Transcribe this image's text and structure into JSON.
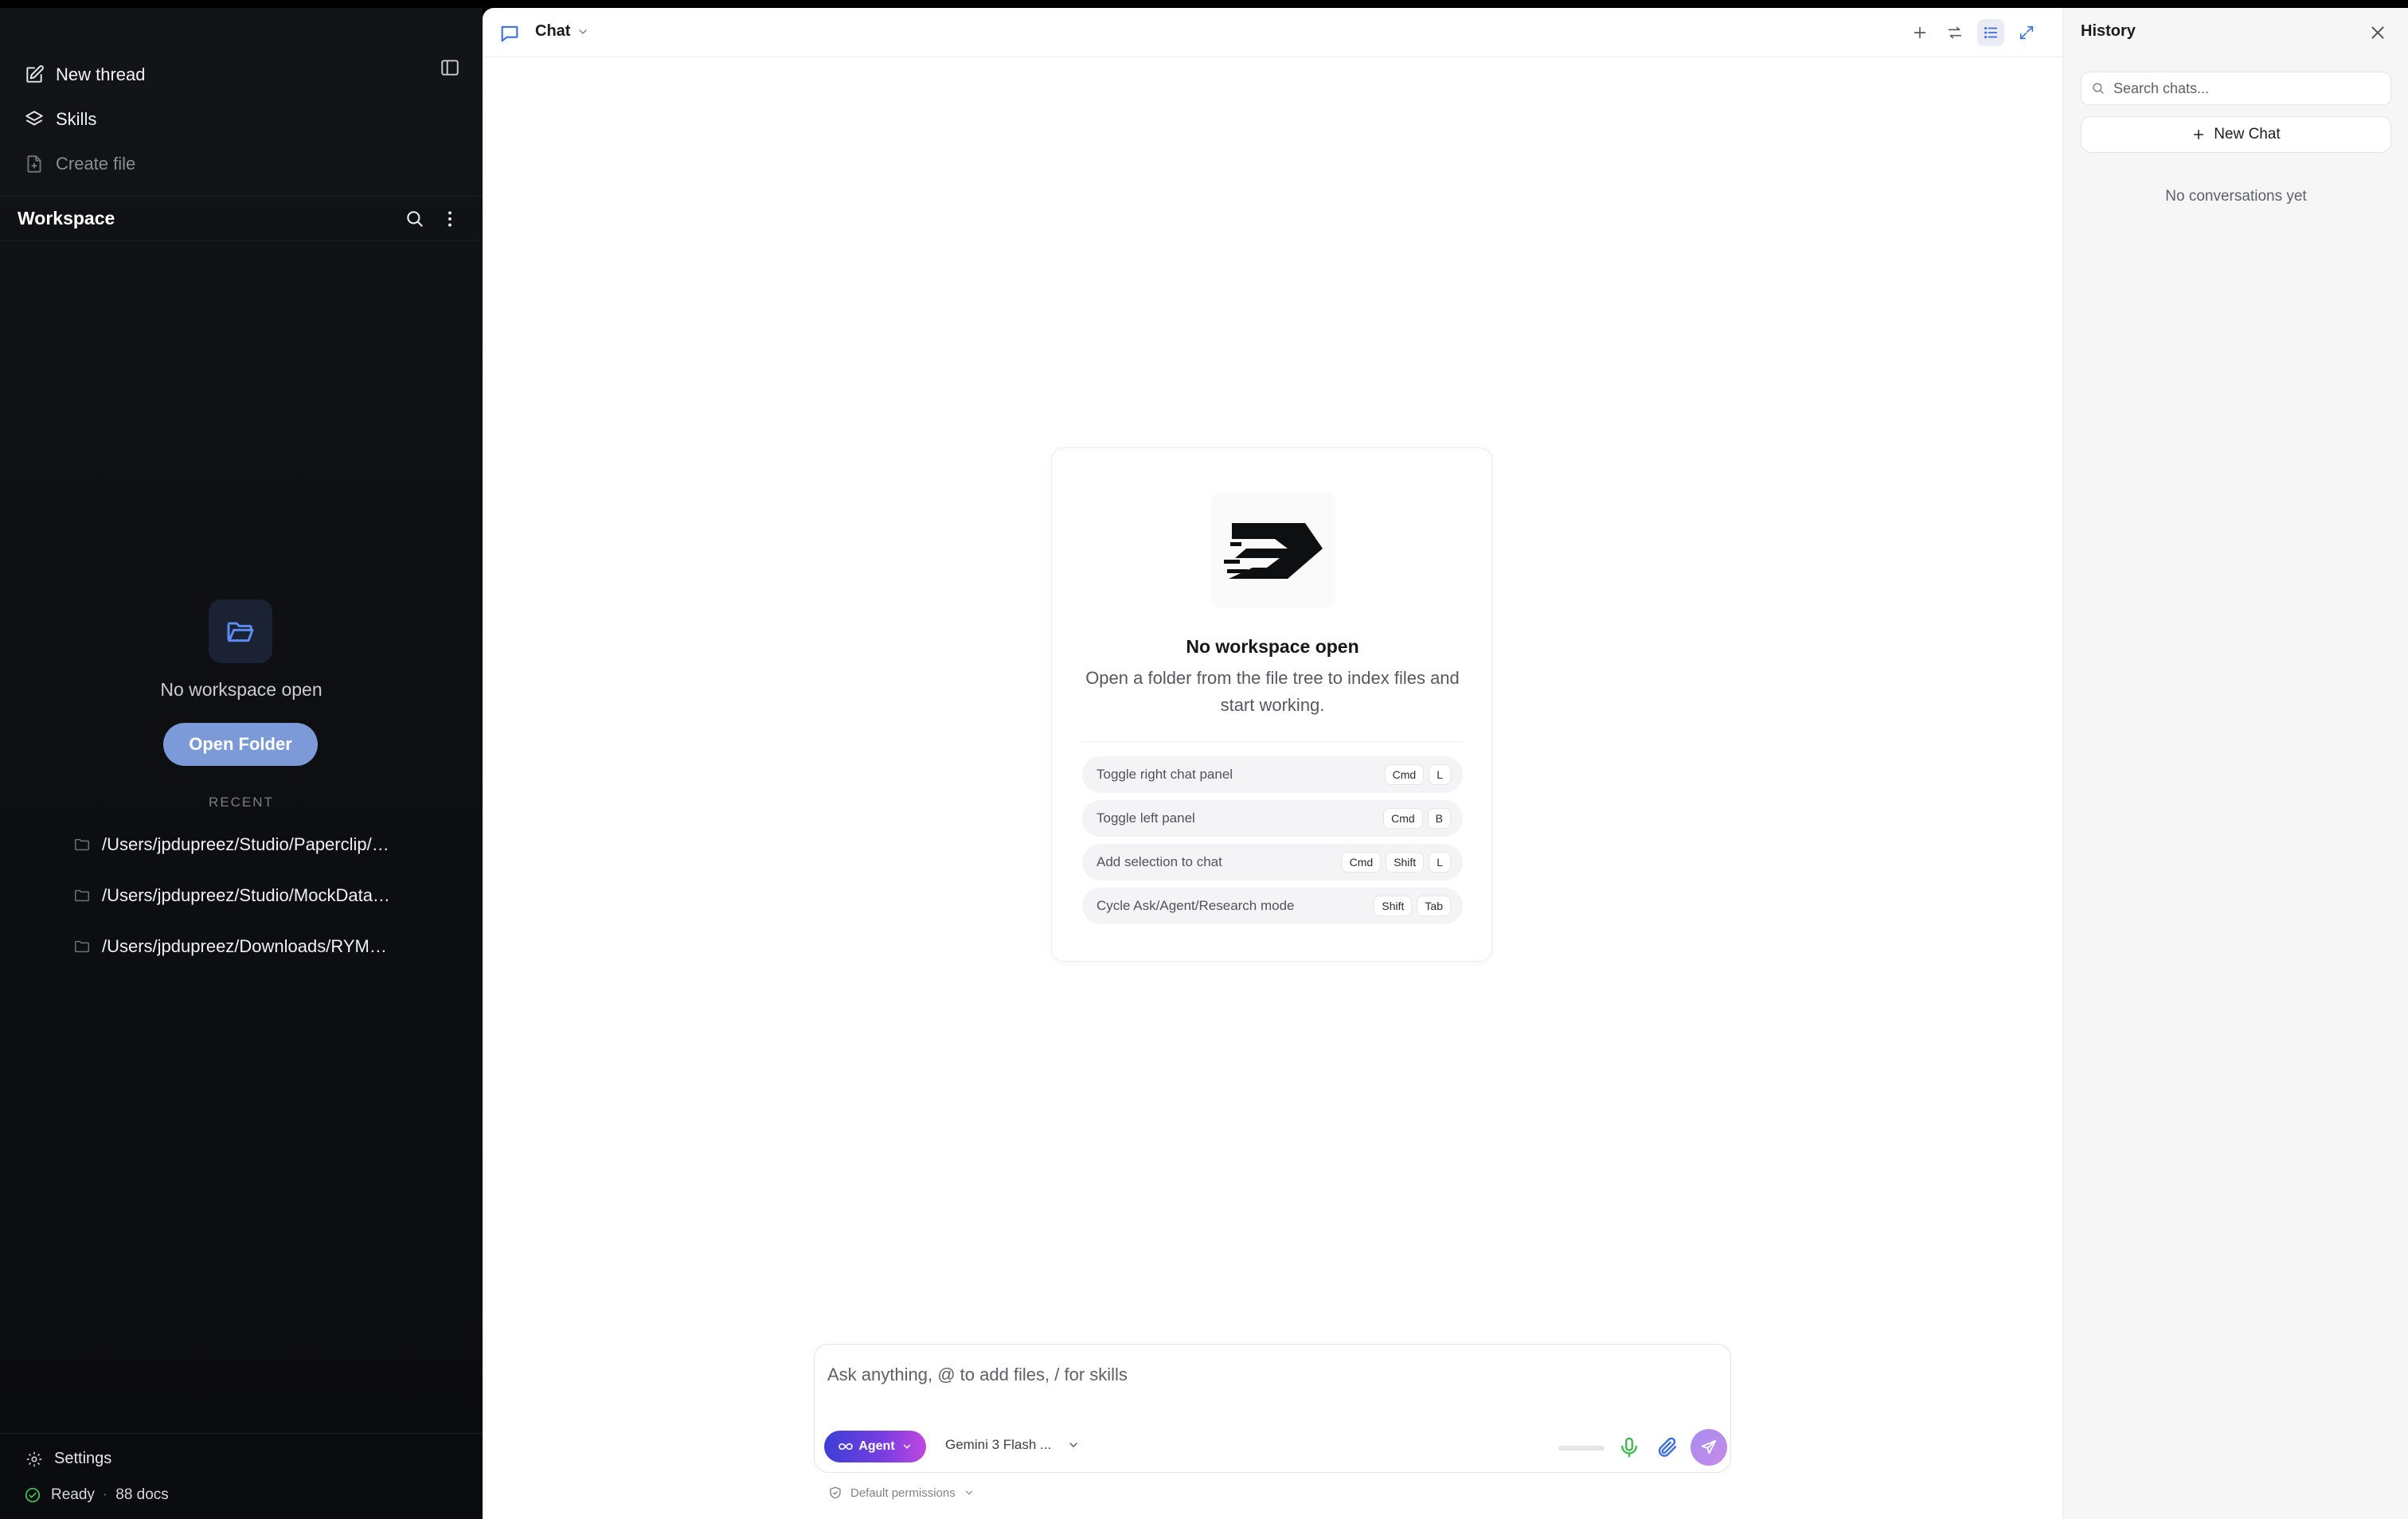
{
  "sidebar": {
    "new_thread": "New thread",
    "skills": "Skills",
    "create_file": "Create file",
    "workspace_title": "Workspace",
    "empty_text": "No workspace open",
    "open_folder": "Open Folder",
    "recent_label": "RECENT",
    "recent": [
      "/Users/jpdupreez/Studio/Paperclip/…",
      "/Users/jpdupreez/Studio/MockData…",
      "/Users/jpdupreez/Downloads/RYM…"
    ],
    "settings": "Settings",
    "status_ready": "Ready",
    "status_sep": "·",
    "status_docs": "88 docs"
  },
  "main": {
    "title": "Chat",
    "welcome": {
      "title": "No workspace open",
      "subtitle": "Open a folder from the file tree to index files and start working."
    },
    "shortcuts": [
      {
        "label": "Toggle right chat panel",
        "keys": [
          "Cmd",
          "L"
        ]
      },
      {
        "label": "Toggle left panel",
        "keys": [
          "Cmd",
          "B"
        ]
      },
      {
        "label": "Add selection to chat",
        "keys": [
          "Cmd",
          "Shift",
          "L"
        ]
      },
      {
        "label": "Cycle Ask/Agent/Research mode",
        "keys": [
          "Shift",
          "Tab"
        ]
      }
    ],
    "composer": {
      "placeholder": "Ask anything, @ to add files, / for skills",
      "mode": "Agent",
      "model": "Gemini 3 Flash ..."
    },
    "permissions": "Default permissions"
  },
  "history": {
    "title": "History",
    "search_placeholder": "Search chats...",
    "new_chat": "New Chat",
    "empty": "No conversations yet"
  },
  "colors": {
    "accent": "#7c9ad8",
    "status_ok": "#3fb950",
    "agent_gradient_start": "#3b3fd6",
    "agent_gradient_end": "#c248e0"
  }
}
